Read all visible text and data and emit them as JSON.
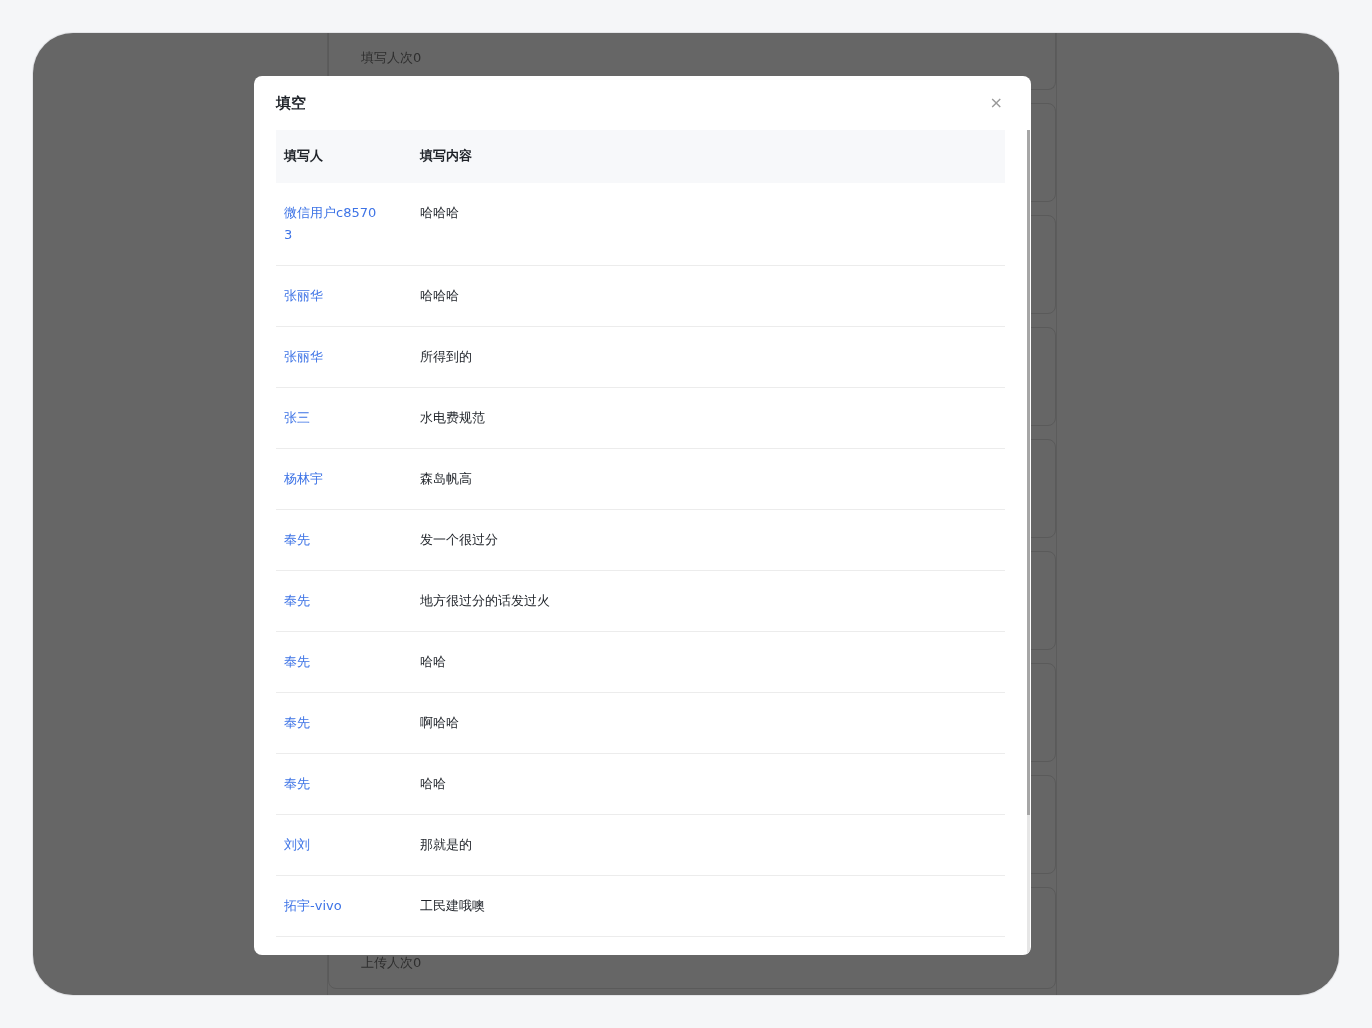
{
  "background": {
    "top_card_text": "填写人次0",
    "bottom_card_text": "上传人次0"
  },
  "dialog": {
    "title": "填空",
    "close": "×",
    "columns": [
      "填写人",
      "填写内容"
    ],
    "rows": [
      {
        "name": "微信用户c85703",
        "content": "哈哈哈"
      },
      {
        "name": "张丽华",
        "content": "哈哈哈"
      },
      {
        "name": "张丽华",
        "content": "所得到的"
      },
      {
        "name": "张三",
        "content": "水电费规范"
      },
      {
        "name": "杨林宇",
        "content": "森岛帆高"
      },
      {
        "name": "奉先",
        "content": "发一个很过分"
      },
      {
        "name": "奉先",
        "content": "地方很过分的话发过火"
      },
      {
        "name": "奉先",
        "content": "哈哈"
      },
      {
        "name": "奉先",
        "content": "啊哈哈"
      },
      {
        "name": "奉先",
        "content": "哈哈"
      },
      {
        "name": "刘刘",
        "content": "那就是的"
      },
      {
        "name": "拓宇-vivo",
        "content": "工民建哦噢"
      }
    ]
  }
}
